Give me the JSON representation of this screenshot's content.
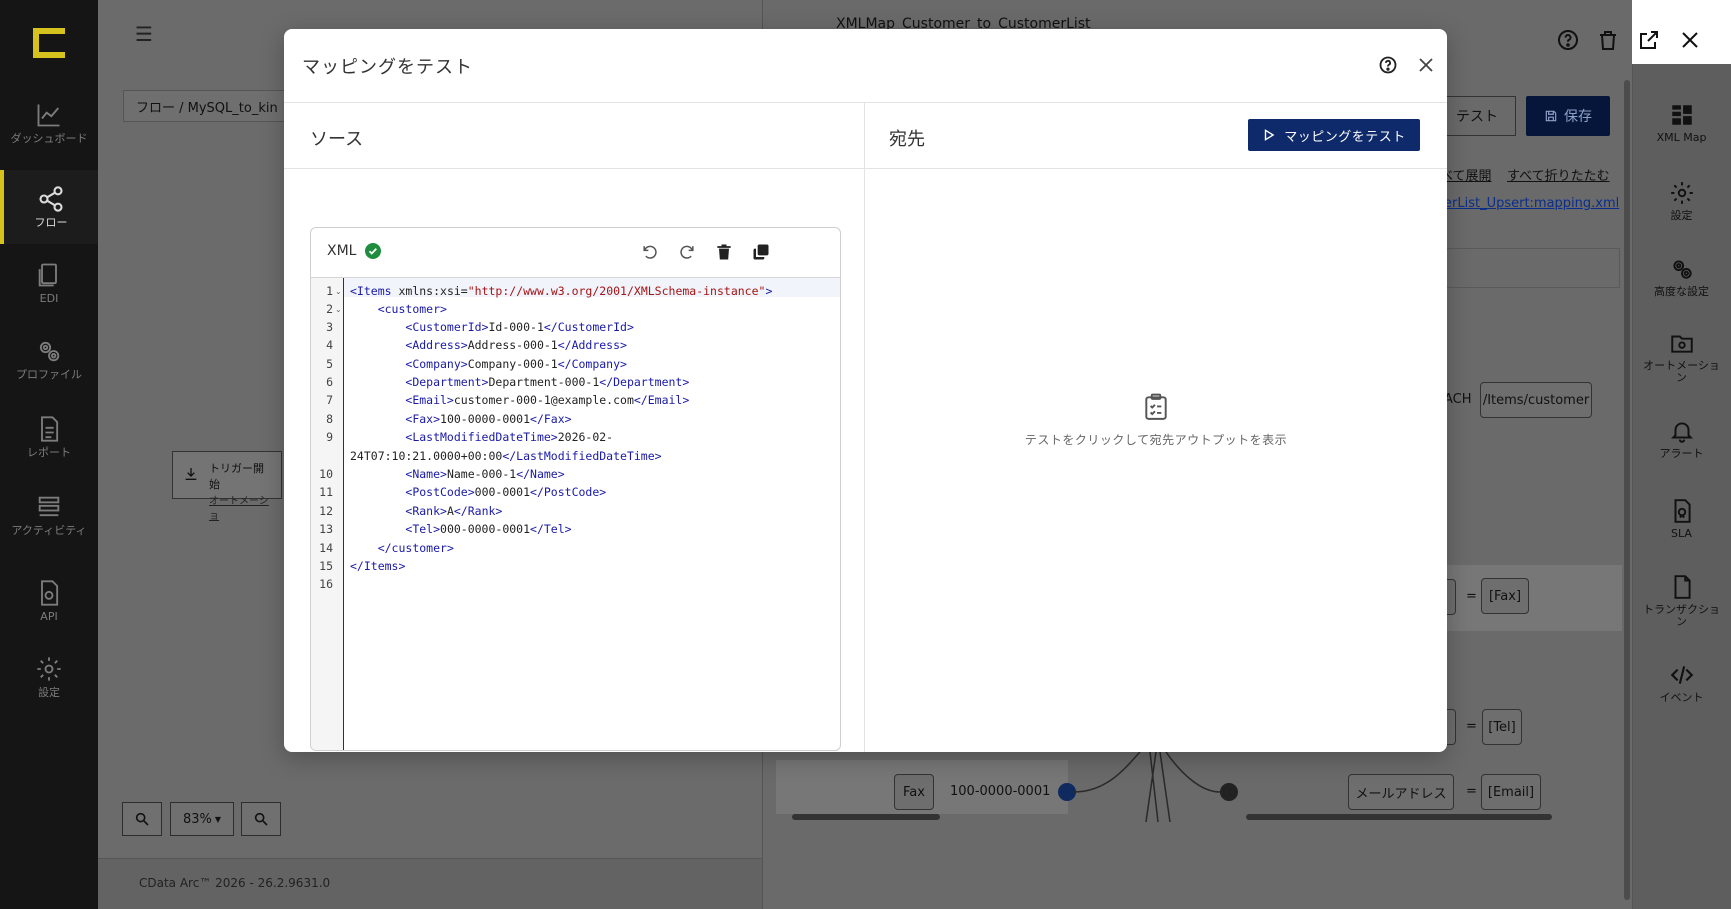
{
  "sidebar": {
    "items": [
      {
        "label": "ダッシュボード",
        "icon": "dashboard-icon"
      },
      {
        "label": "フロー",
        "icon": "flow-icon",
        "active": true
      },
      {
        "label": "EDI",
        "icon": "edi-icon"
      },
      {
        "label": "プロファイル",
        "icon": "profile-icon"
      },
      {
        "label": "レポート",
        "icon": "report-icon"
      },
      {
        "label": "アクティビティ",
        "icon": "activity-icon"
      },
      {
        "label": "API",
        "icon": "api-icon"
      },
      {
        "label": "設定",
        "icon": "settings-icon"
      }
    ]
  },
  "background": {
    "breadcrumb": "フロー /   MySQL_to_kin",
    "panel_title": "XMLMap_Customer_to_CustomerList",
    "trigger": {
      "title": "トリガー開始",
      "subtitle": "オートメーショ"
    },
    "zoom_level": "83%",
    "footer": "CData Arc™ 2026 - 26.2.9631.0",
    "test_button": "テスト",
    "save_button": "保存",
    "expand_all": "べて展開",
    "collapse_all": "すべて折りたたむ",
    "mapping_file": "erList_Upsert:mapping.xml",
    "foreach_label": "ACH",
    "foreach_path": "/Items/customer",
    "fax_chip": "[Fax]",
    "tel_chip": "[Tel]",
    "email_label": "メールアドレス",
    "email_chip": "[Email]",
    "fax_label": "Fax",
    "fax_value": "100-0000-0001",
    "eq": "="
  },
  "right_rail": {
    "items": [
      {
        "label": "XML Map",
        "icon": "xml-map-icon"
      },
      {
        "label": "設定",
        "icon": "settings-icon"
      },
      {
        "label": "高度な設定",
        "icon": "advanced-settings-icon"
      },
      {
        "label": "オートメーション",
        "icon": "automation-icon"
      },
      {
        "label": "アラート",
        "icon": "alert-bell-icon"
      },
      {
        "label": "SLA",
        "icon": "sla-icon"
      },
      {
        "label": "トランザクション",
        "icon": "transaction-icon"
      },
      {
        "label": "イベント",
        "icon": "event-code-icon"
      }
    ]
  },
  "modal": {
    "title": "マッピングをテスト",
    "source": {
      "title": "ソース",
      "format": "XML",
      "lines": [
        "1",
        "2",
        "3",
        "4",
        "5",
        "6",
        "7",
        "8",
        "9",
        "",
        "10",
        "11",
        "12",
        "13",
        "14",
        "15",
        "16"
      ]
    },
    "destination": {
      "title": "宛先",
      "run_button": "マッピングをテスト",
      "empty_message": "テストをクリックして宛先アウトプットを表示"
    }
  },
  "colors": {
    "accent": "#0e2a6b",
    "valid": "#1e8e3e",
    "logo": "#d6c21d"
  }
}
